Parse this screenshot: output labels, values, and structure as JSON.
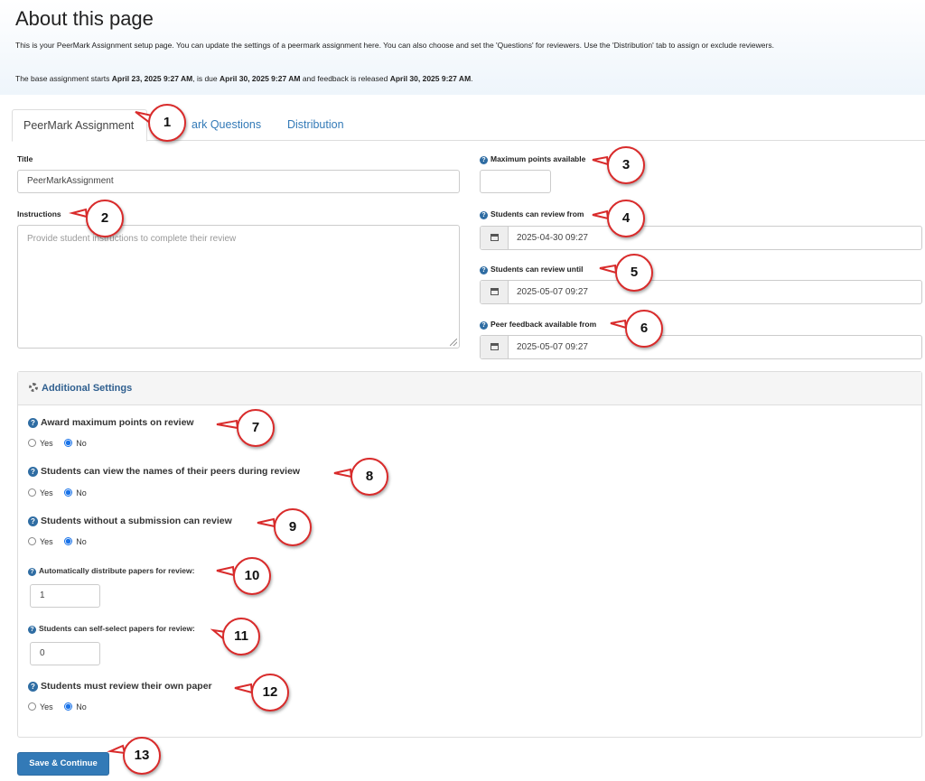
{
  "header": {
    "title": "About this page",
    "intro": "This is your PeerMark Assignment setup page. You can update the settings of a peermark assignment here. You can also choose and set the 'Questions' for reviewers. Use the 'Distribution' tab to assign or exclude reviewers.",
    "dates_prefix": "The base assignment starts ",
    "start_date": "April 23, 2025 9:27 AM",
    "dates_mid1": ", is due ",
    "due_date": "April 30, 2025 9:27 AM",
    "dates_mid2": " and feedback is released ",
    "feedback_date": "April 30, 2025 9:27 AM",
    "dates_suffix": "."
  },
  "tabs": [
    {
      "label": "PeerMark Assignment",
      "active": true
    },
    {
      "label": "ark Questions",
      "active": false
    },
    {
      "label": "Distribution",
      "active": false
    }
  ],
  "form": {
    "title_label": "Title",
    "title_value": "PeerMarkAssignment",
    "instructions_label": "Instructions",
    "instructions_placeholder": "Provide student      instructions to complete their review",
    "max_points_label": "Maximum points available",
    "max_points_value": "",
    "review_from_label": "Students can review from",
    "review_from_value": "2025-04-30 09:27",
    "review_until_label": "Students can review until",
    "review_until_value": "2025-05-07 09:27",
    "feedback_from_label": "Peer feedback available from",
    "feedback_from_value": "2025-05-07 09:27"
  },
  "additional": {
    "title": "Additional Settings",
    "yes_label": "Yes",
    "no_label": "No",
    "award_label": "Award maximum points on review",
    "award_value": "No",
    "view_names_label": "Students can view the names of their peers during review",
    "view_names_value": "No",
    "no_submission_label": "Students without a submission can review",
    "no_submission_value": "No",
    "auto_distribute_label": "Automatically distribute papers for review:",
    "auto_distribute_value": "1",
    "self_select_label": "Students can self-select papers for review:",
    "self_select_value": "0",
    "own_paper_label": "Students must review their own paper",
    "own_paper_value": "No"
  },
  "save_label": "Save & Continue",
  "callouts": [
    "1",
    "2",
    "3",
    "4",
    "5",
    "6",
    "7",
    "8",
    "9",
    "10",
    "11",
    "12",
    "13"
  ],
  "colors": {
    "accent": "#337ab7",
    "callout_border": "#d92b2b"
  }
}
